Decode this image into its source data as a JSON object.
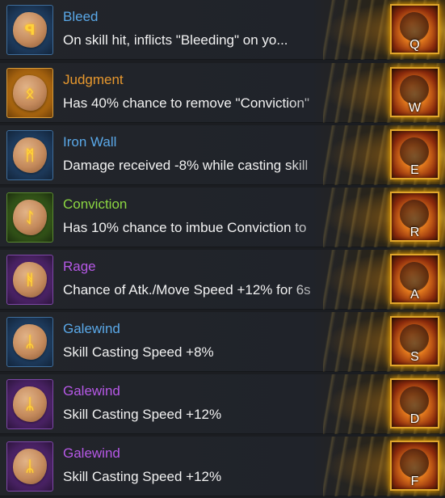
{
  "colors": {
    "blue": "#5aa8e8",
    "orange": "#e8982e",
    "green": "#8cd642",
    "purple": "#b658e6",
    "description": "#f2f2f2",
    "frame_gold": "#e0a52a"
  },
  "rows": [
    {
      "name": "Bleed",
      "name_color": "#5aa8e8",
      "frame": "blue",
      "glyph": "ꟼ",
      "icon": "rune-bleed-icon",
      "description": "On skill hit, inflicts \"Bleeding\" on yo...",
      "skill_icon": "bomb-skill-icon",
      "key": "Q"
    },
    {
      "name": "Judgment",
      "name_color": "#e8982e",
      "frame": "orange",
      "glyph": "ᛟ",
      "icon": "rune-judgment-icon",
      "description": "Has 40% chance to remove \"Conviction\"",
      "skill_icon": "crossed-blast-skill-icon",
      "key": "W"
    },
    {
      "name": "Iron Wall",
      "name_color": "#5aa8e8",
      "frame": "blue",
      "glyph": "ᛗ",
      "icon": "rune-iron-wall-icon",
      "description": "Damage received -8% while casting skill",
      "skill_icon": "gun-skill-icon",
      "key": "E"
    },
    {
      "name": "Conviction",
      "name_color": "#8cd642",
      "frame": "green",
      "glyph": "ᛇ",
      "icon": "rune-conviction-icon",
      "description": "Has 10% chance to imbue Conviction to",
      "skill_icon": "revolver-skill-icon",
      "key": "R"
    },
    {
      "name": "Rage",
      "name_color": "#b658e6",
      "frame": "purple",
      "glyph": "ᚻ",
      "icon": "rune-rage-icon",
      "description": "Chance of Atk./Move Speed +12% for 6s",
      "skill_icon": "gunner-skill-icon",
      "key": "A"
    },
    {
      "name": "Galewind",
      "name_color": "#5aa8e8",
      "frame": "blue",
      "glyph": "ᛦ",
      "icon": "rune-galewind-icon",
      "description": "Skill Casting Speed +8%",
      "skill_icon": "bullet-skill-icon",
      "key": "S"
    },
    {
      "name": "Galewind",
      "name_color": "#b658e6",
      "frame": "purple",
      "glyph": "ᛦ",
      "icon": "rune-galewind-icon",
      "description": "Skill Casting Speed +12%",
      "skill_icon": "rocket-skill-icon",
      "key": "D"
    },
    {
      "name": "Galewind",
      "name_color": "#b658e6",
      "frame": "purple",
      "glyph": "ᛦ",
      "icon": "rune-galewind-icon",
      "description": "Skill Casting Speed +12%",
      "skill_icon": "burst-skill-icon",
      "key": "F"
    }
  ]
}
